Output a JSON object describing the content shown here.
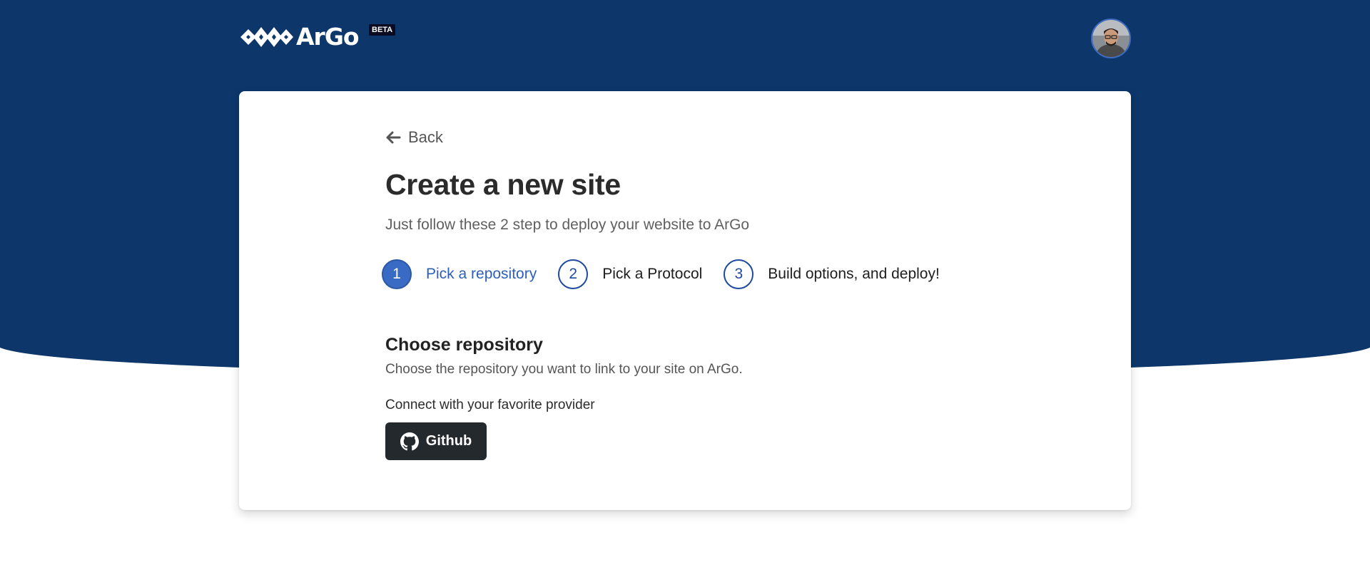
{
  "brand": {
    "name": "ArGo",
    "badge": "BETA",
    "colors": {
      "header_bg": "#0d366b",
      "primary": "#2d5fb8",
      "github_bg": "#24292e"
    }
  },
  "header": {
    "avatar_icon": "user-avatar"
  },
  "card": {
    "back_label": "Back",
    "title": "Create a new site",
    "subtitle": "Just follow these 2 step to deploy your website to ArGo",
    "steps": [
      {
        "number": "1",
        "label": "Pick a repository",
        "active": true
      },
      {
        "number": "2",
        "label": "Pick a Protocol",
        "active": false
      },
      {
        "number": "3",
        "label": "Build options, and deploy!",
        "active": false
      }
    ],
    "section": {
      "title": "Choose repository",
      "description": "Choose the repository you want to link to your site on ArGo.",
      "provider_label": "Connect with your favorite provider",
      "github_label": "Github"
    }
  }
}
